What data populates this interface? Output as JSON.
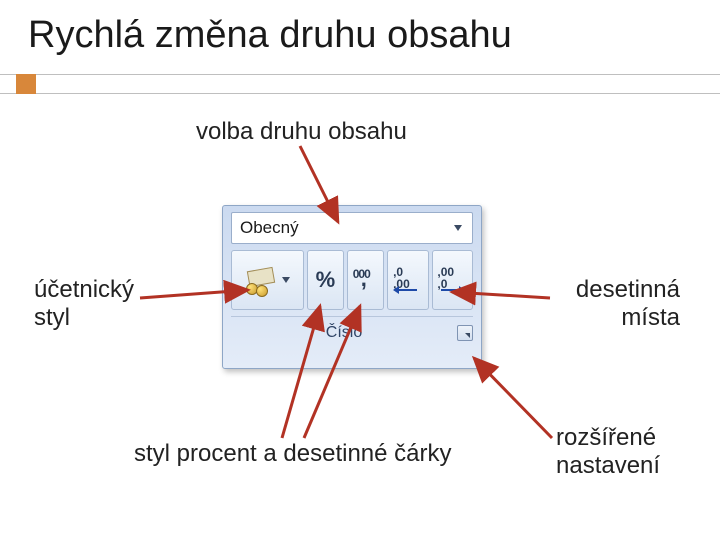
{
  "title": "Rychlá změna druhu obsahu",
  "labels": {
    "volba": "volba druhu obsahu",
    "ucetnicky_l1": "účetnický",
    "ucetnicky_l2": "styl",
    "desetinna_l1": "desetinná",
    "desetinna_l2": "místa",
    "styl_procent": "styl procent a desetinné čárky",
    "rozsirene_l1": "rozšířené",
    "rozsirene_l2": "nastavení"
  },
  "ribbon": {
    "format_value": "Obecný",
    "group_caption": "Číslo",
    "buttons": {
      "accounting": "accounting-number-format",
      "percent_glyph": "%",
      "comma_style": "comma-style",
      "increase_decimal": "increase-decimal",
      "decrease_decimal": "decrease-decimal"
    }
  },
  "colors": {
    "arrow": "#b23224",
    "accent": "#d8873a"
  }
}
